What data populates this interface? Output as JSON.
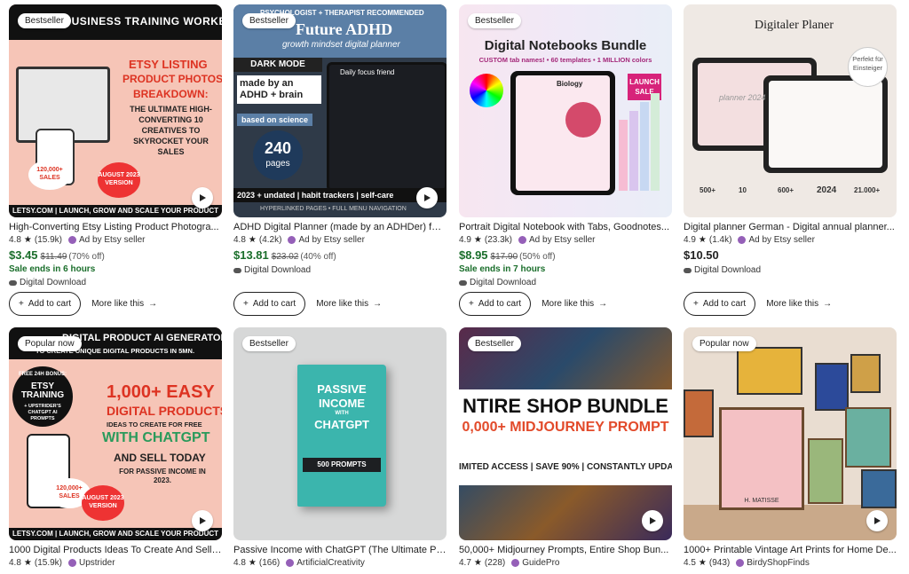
{
  "row1": [
    {
      "badge": "Bestseller",
      "img_text": [
        "SMALL BUSINESS TRAINING WORKBOOK",
        "ETSY LISTING",
        "PRODUCT PHOTOS",
        "BREAKDOWN:",
        "THE ULTIMATE HIGH-CONVERTING 10 CREATIVES TO SKYROCKET YOUR SALES",
        "120,000+ SALES",
        "AUGUST 2023 VERSION",
        "LETSY.COM | LAUNCH, GROW AND SCALE YOUR PRODUCT"
      ],
      "title": "High-Converting Etsy Listing Product Photogra...",
      "rating": "4.8",
      "reviews": "(15.9k)",
      "seller": "Ad by Etsy seller",
      "price": "$3.45",
      "orig": "$11.49",
      "off": "(70% off)",
      "sale": "Sale ends in 6 hours",
      "download": "Digital Download"
    },
    {
      "badge": "Bestseller",
      "img_text": [
        "PSYCHOLOGIST + THERAPIST RECOMMENDED",
        "Future ADHD",
        "growth mindset digital planner",
        "DARK MODE",
        "made by an ADHD + brain",
        "based on science",
        "240",
        "pages",
        "2023 + undated | habit trackers | self-care",
        "HYPERLINKED PAGES • FULL MENU NAVIGATION",
        "Daily focus friend"
      ],
      "title": "ADHD Digital Planner (made by an ADHDer) for ...",
      "rating": "4.8",
      "reviews": "(4.2k)",
      "seller": "Ad by Etsy seller",
      "price": "$13.81",
      "orig": "$23.02",
      "off": "(40% off)",
      "sale": "",
      "download": "Digital Download"
    },
    {
      "badge": "Bestseller",
      "img_text": [
        "Digital Notebooks Bundle",
        "CUSTOM tab names! • 60 templates • 1 MILLION colors",
        "LAUNCH SALE",
        "Biology"
      ],
      "title": "Portrait Digital Notebook with Tabs, Goodnotes...",
      "rating": "4.9",
      "reviews": "(23.3k)",
      "seller": "Ad by Etsy seller",
      "price": "$8.95",
      "orig": "$17.90",
      "off": "(50% off)",
      "sale": "Sale ends in 7 hours",
      "download": "Digital Download"
    },
    {
      "badge": "",
      "img_text": [
        "Digitaler Planer",
        "Perfekt für Einsteiger",
        "500+",
        "10",
        "600+",
        "2024",
        "21.000+",
        "planner 2024"
      ],
      "title": "Digital planner German - Digital annual planner...",
      "rating": "4.9",
      "reviews": "(1.4k)",
      "seller": "Ad by Etsy seller",
      "price": "$10.50",
      "orig": "",
      "off": "",
      "sale": "",
      "download": "Digital Download"
    }
  ],
  "row2": [
    {
      "badge": "Popular now",
      "img_text": [
        "DIGITAL PRODUCT AI GENERATOR",
        "TO CREATE UNIQUE DIGITAL PRODUCTS IN 5MN.",
        "FREE 24H BONUS:",
        "ETSY TRAINING",
        "+ UPSTRIDER'S CHATGPT AI PROMPTS",
        "1,000+ EASY",
        "DIGITAL PRODUCTS",
        "IDEAS TO CREATE FOR FREE",
        "WITH CHATGPT",
        "AND SELL TODAY",
        "FOR PASSIVE INCOME IN 2023.",
        "120,000+ SALES",
        "AUGUST 2023 VERSION",
        "LETSY.COM | LAUNCH, GROW AND SCALE YOUR PRODUCT"
      ],
      "title": "1000 Digital Products Ideas To Create And Sell ...",
      "rating": "4.8",
      "reviews": "(15.9k)",
      "seller": "Upstrider"
    },
    {
      "badge": "Bestseller",
      "img_text": [
        "PASSIVE",
        "INCOME",
        "WITH",
        "CHATGPT",
        "500 PROMPTS"
      ],
      "title": "Passive Income with ChatGPT (The Ultimate Pr...",
      "rating": "4.8",
      "reviews": "(166)",
      "seller": "ArtificialCreativity"
    },
    {
      "badge": "Bestseller",
      "img_text": [
        "NTIRE SHOP BUNDLE",
        "0,000+ MIDJOURNEY PROMPT",
        "IMITED ACCESS | SAVE 90% | CONSTANTLY UPDA"
      ],
      "title": "50,000+ Midjourney Prompts, Entire Shop Bun...",
      "rating": "4.7",
      "reviews": "(228)",
      "seller": "GuidePro"
    },
    {
      "badge": "Popular now",
      "img_text": [
        "H. MATISSE"
      ],
      "title": "1000+ Printable Vintage Art Prints for Home De...",
      "rating": "4.5",
      "reviews": "(943)",
      "seller": "BirdyShopFinds"
    }
  ],
  "actions": {
    "add_to_cart": "Add to cart",
    "more_like_this": "More like this"
  },
  "colors": {
    "sale_green": "#1a6e2b",
    "seller_icon": "#9560b8"
  }
}
